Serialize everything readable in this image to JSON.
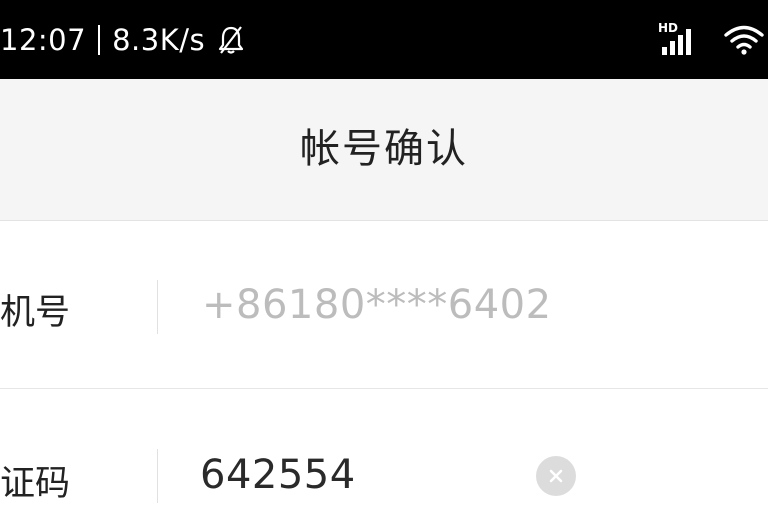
{
  "status_bar": {
    "time": "12:07",
    "net_speed": "8.3K/s",
    "signal_label": "HD",
    "icons": [
      "bell-off-icon",
      "signal-icon",
      "wifi-icon"
    ]
  },
  "header": {
    "title": "帐号确认"
  },
  "form": {
    "phone": {
      "label": "机号",
      "value": "+86180****6402"
    },
    "code": {
      "label": "证码",
      "value": "642554"
    },
    "clear_icon": "clear-icon"
  },
  "colors": {
    "status_bar_bg": "#000000",
    "title_bar_bg": "#f5f5f5",
    "placeholder_gray": "#bcbcbc",
    "clear_button_bg": "#dcdcdc"
  }
}
